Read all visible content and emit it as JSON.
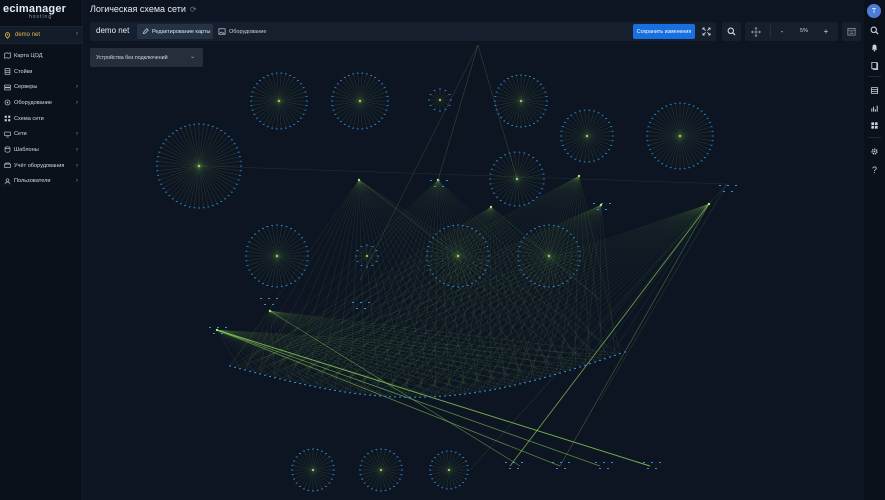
{
  "brand": {
    "line1": "ecimanager",
    "line2": "hosting"
  },
  "site_selector": {
    "label": "demo net"
  },
  "nav": [
    {
      "label": "Карта ЦОД",
      "icon": "map-icon",
      "has_children": false
    },
    {
      "label": "Стойки",
      "icon": "rack-icon",
      "has_children": false
    },
    {
      "label": "Серверы",
      "icon": "server-icon",
      "has_children": true
    },
    {
      "label": "Оборудование",
      "icon": "equipment-icon",
      "has_children": true
    },
    {
      "label": "Схема сети",
      "icon": "network-scheme-icon",
      "has_children": false
    },
    {
      "label": "Сети",
      "icon": "networks-icon",
      "has_children": true
    },
    {
      "label": "Шаблоны",
      "icon": "templates-icon",
      "has_children": true
    },
    {
      "label": "Учёт оборудования",
      "icon": "inventory-icon",
      "has_children": true
    },
    {
      "label": "Пользователи",
      "icon": "users-icon",
      "has_children": true
    }
  ],
  "header": {
    "title": "Логическая схема сети"
  },
  "toolbar": {
    "location_name": "demo net",
    "edit_map_label": "Редактирование карты",
    "equipment_label": "Оборудование",
    "save_label": "Сохранить изменения"
  },
  "zoom": {
    "minus": "-",
    "value": "5%",
    "plus": "+"
  },
  "unlinked_dropdown": {
    "label": "Устройства без подключений"
  },
  "rightbar": {
    "avatar_initial": "T",
    "help": "?"
  },
  "colors": {
    "accent": "#1a6fe0",
    "node": "#2f8fe0",
    "link": "#8fd35b",
    "hub": "#b3e86a",
    "brand_yellow": "#e8b64a"
  }
}
